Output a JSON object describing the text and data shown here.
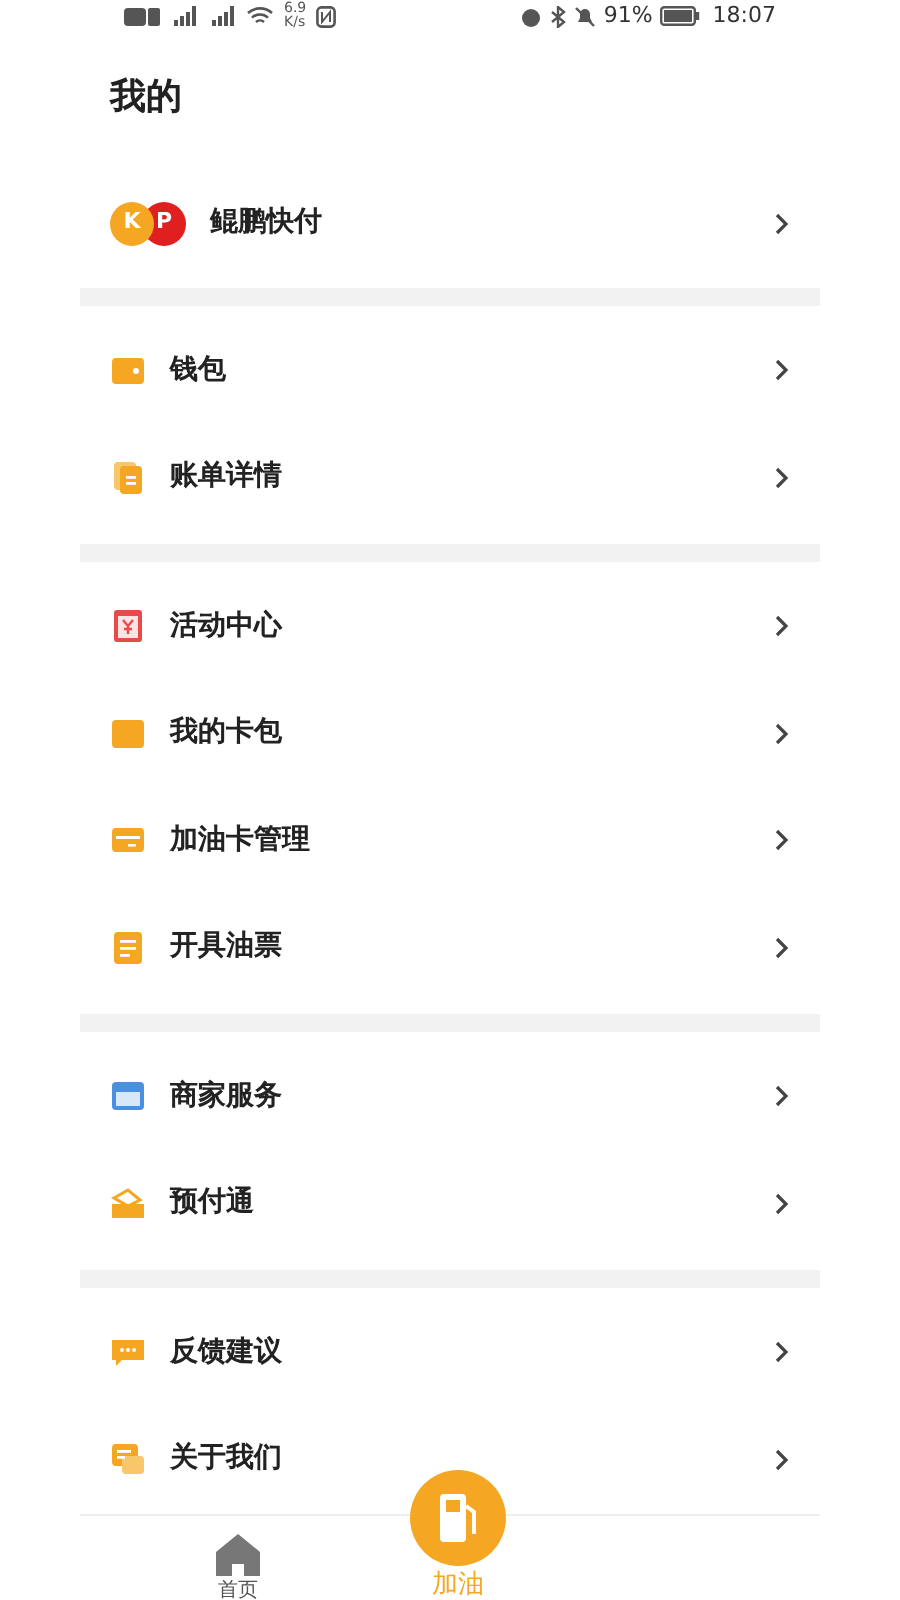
{
  "status_bar": {
    "speed_value": "6.9",
    "speed_unit": "K/s",
    "battery": "91%",
    "time": "18:07"
  },
  "title": "我的",
  "account": {
    "name": "鲲鹏快付",
    "logo_letters": [
      "K",
      "P"
    ]
  },
  "sections": [
    {
      "items": [
        {
          "label": "钱包"
        },
        {
          "label": "账单详情"
        }
      ]
    },
    {
      "items": [
        {
          "label": "活动中心"
        },
        {
          "label": "我的卡包"
        },
        {
          "label": "加油卡管理"
        },
        {
          "label": "开具油票"
        }
      ]
    },
    {
      "items": [
        {
          "label": "商家服务"
        },
        {
          "label": "预付通"
        }
      ]
    },
    {
      "items": [
        {
          "label": "反馈建议"
        },
        {
          "label": "关于我们"
        }
      ]
    }
  ],
  "tabs": [
    {
      "label": "首页",
      "selected": false
    },
    {
      "label": "加油",
      "selected": true
    }
  ]
}
